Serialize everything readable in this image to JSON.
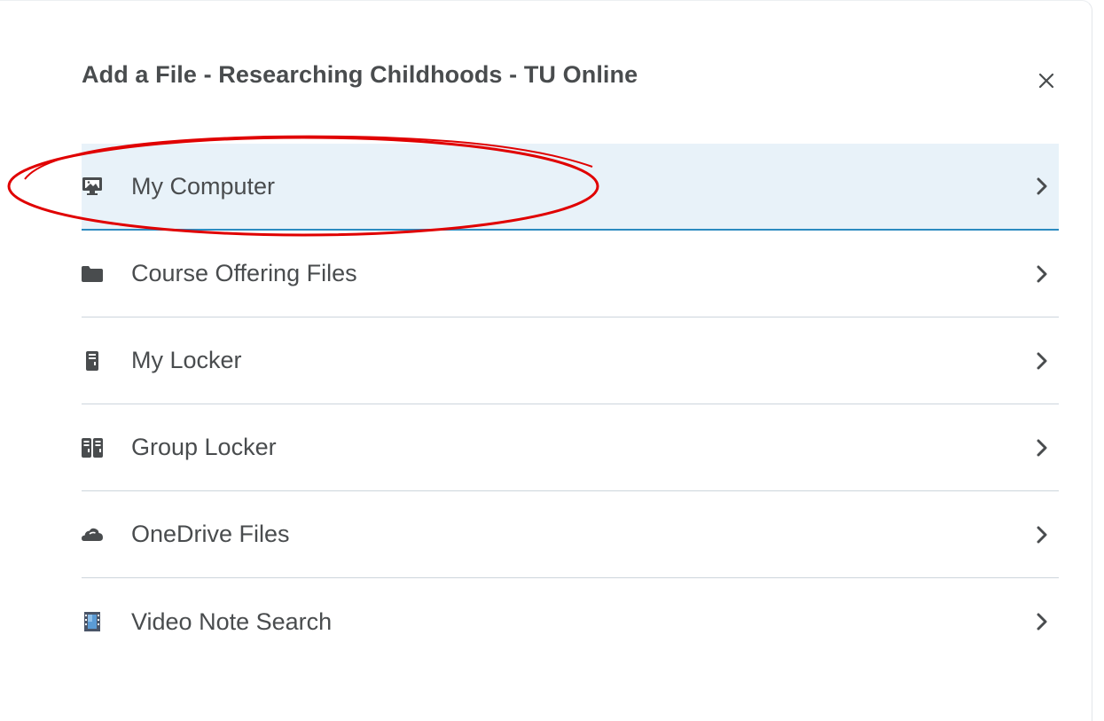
{
  "dialog": {
    "title": "Add a File - Researching Childhoods - TU Online",
    "close_icon": "close-icon"
  },
  "sources": [
    {
      "label": "My Computer",
      "icon": "desktop-computer-icon",
      "selected": true
    },
    {
      "label": "Course Offering Files",
      "icon": "folder-icon",
      "selected": false
    },
    {
      "label": "My Locker",
      "icon": "locker-icon",
      "selected": false
    },
    {
      "label": "Group Locker",
      "icon": "group-locker-icon",
      "selected": false
    },
    {
      "label": "OneDrive Files",
      "icon": "cloud-icon",
      "selected": false
    },
    {
      "label": "Video Note Search",
      "icon": "video-note-icon",
      "selected": false
    }
  ],
  "annotation": {
    "color": "#e00000",
    "target": "My Computer"
  },
  "colors": {
    "text": "#494c4e",
    "selected_bg": "#e8f2f9",
    "selected_border": "#2b8bc0",
    "divider": "#cdd5dc"
  }
}
